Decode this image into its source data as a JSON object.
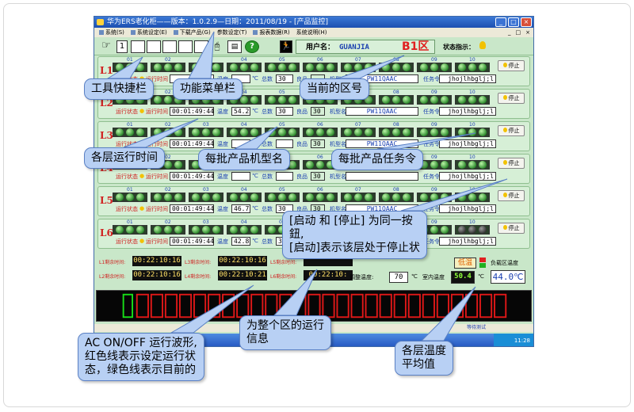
{
  "window": {
    "title": "华为ERS老化柜——版本：1.0.2.9—日期：2011/08/19 - [产品监控]"
  },
  "menu": {
    "items": [
      "系统(S)",
      "系统设定(E)",
      "下载产品(G)",
      "参数设定(T)",
      "报表数据(R)",
      "系统说明(H)"
    ],
    "right": [
      "_",
      "□",
      "×"
    ]
  },
  "toolbar": {
    "page": "1",
    "help": "?",
    "user_label": "用户名：",
    "user_name": "GUANJIA",
    "zone": "B1区",
    "status_label": "状态指示："
  },
  "slot_numbers": [
    "01",
    "02",
    "03",
    "04",
    "05",
    "06",
    "07",
    "08",
    "09",
    "10"
  ],
  "layers": [
    {
      "label": "L1",
      "run_time": "",
      "temp": "",
      "total": "30",
      "good": "",
      "model": "PW11QAAC",
      "task": "jhojlhbglj;l",
      "lights": [
        3,
        3,
        3,
        3,
        3,
        3,
        3,
        3,
        3,
        3
      ]
    },
    {
      "label": "L2",
      "run_time": "00:01:49:44",
      "temp": "54.2",
      "total": "30",
      "good": "30",
      "model": "PW11QAAC",
      "task": "jhojlhbglj;l",
      "lights": [
        3,
        3,
        3,
        3,
        3,
        3,
        3,
        3,
        3,
        3
      ]
    },
    {
      "label": "L3",
      "run_time": "00:01:49:44",
      "temp": "",
      "total": "",
      "good": "30",
      "model": "PW11QAAC",
      "task": "jhojlhbglj;l",
      "lights": [
        3,
        3,
        3,
        3,
        3,
        3,
        3,
        3,
        3,
        3
      ]
    },
    {
      "label": "L4",
      "run_time": "00:01:49:44",
      "temp": "",
      "total": "",
      "good": "30",
      "model": "",
      "task": "jhojlhbglj;l",
      "lights": [
        3,
        3,
        3,
        3,
        3,
        3,
        3,
        3,
        3,
        3
      ]
    },
    {
      "label": "L5",
      "run_time": "00:01:49:44",
      "temp": "46.7",
      "total": "30",
      "good": "30",
      "model": "PW11QAAC",
      "task": "jhojlhbglj;l",
      "lights": [
        3,
        3,
        3,
        3,
        3,
        3,
        3,
        3,
        3,
        3
      ]
    },
    {
      "label": "L6",
      "run_time": "00:01:49:44",
      "temp": "42.8",
      "total": "30",
      "good": "30",
      "model": "PW11QAAC",
      "task": "jhojlhbglj;l",
      "lights": [
        3,
        3,
        3,
        3,
        3,
        3,
        3,
        3,
        3,
        0
      ]
    }
  ],
  "labels": {
    "run_state": "运行状态",
    "run_time": "运行时间",
    "temp": "温度",
    "unit": "℃",
    "total": "总数",
    "good": "良品",
    "model": "机型名",
    "task": "任务令",
    "stop": "停止"
  },
  "remaining": [
    {
      "label": "L1剩余时间:",
      "value": "00:22:10:16"
    },
    {
      "label": "L3剩余时间:",
      "value": "00:22:10:16"
    },
    {
      "label": "L5剩余时间:",
      "value": ""
    },
    {
      "label": "L2剩余时间:",
      "value": "00:22:10:16"
    },
    {
      "label": "L4剩余时间:",
      "value": "00:22:10:21"
    },
    {
      "label": "L6剩余时间:",
      "value": "00:22:10:"
    }
  ],
  "temps": {
    "low": "低温",
    "load_label": "负载区温度",
    "adjust_label": "调整温度:",
    "adjust": "70",
    "unit": "℃",
    "room_label": "室内温度",
    "room": "50.4",
    "room_unit": "℃",
    "load": "44.0℃"
  },
  "statusbar": "等待测试",
  "tray_time": "11:28",
  "callouts": {
    "toolbar": "工具快捷栏",
    "menu": "功能菜单栏",
    "zone": "当前的区号",
    "runtime": "各层运行时间",
    "model": "每批产品机型名",
    "task": "每批产品任务令",
    "startstop": "[启动 和 [停止] 为同一按\n鈕,\n[启动]表示该层处于停止状",
    "info": "为整个区的运行\n信息",
    "wave": "AC ON/OFF 运行波形,\n红色线表示设定运行状\n态，绿色线表示目前的",
    "avgtemp": "各层温度\n平均值"
  },
  "colors": {
    "wave_red": "#e01818",
    "wave_green": "#18e018",
    "callout_fill": "#b8d0f4",
    "callout_stroke": "#5a80c4"
  }
}
